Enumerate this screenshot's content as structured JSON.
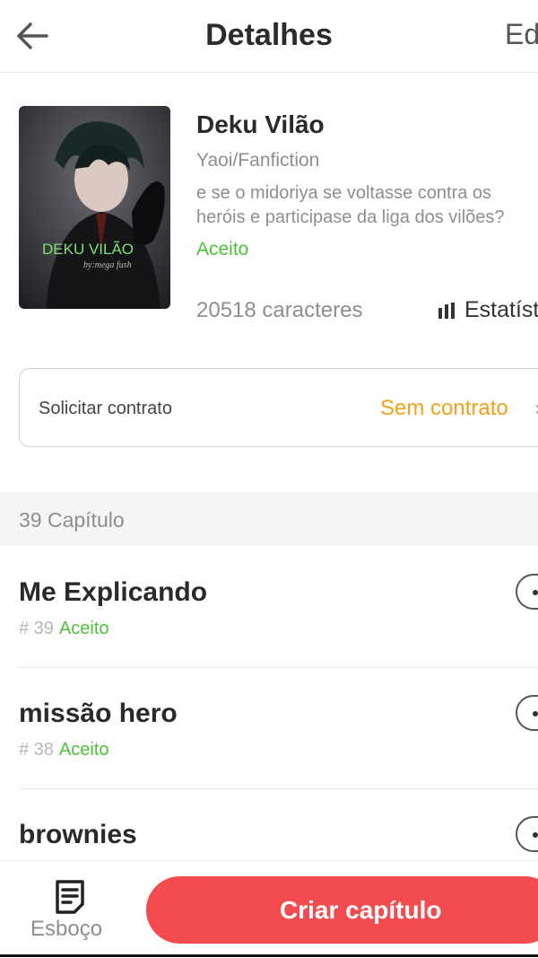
{
  "header": {
    "back_icon": "arrow-left-icon",
    "title": "Detalhes",
    "edit_label": "Ed"
  },
  "book": {
    "cover_text": "DEKU  VILÃO",
    "cover_signature": "by:mega fush",
    "title": "Deku Vilão",
    "genre": "Yaoi/Fanfiction",
    "description_line1": "e se o midoriya se voltasse contra os",
    "description_line2": "heróis e participase da liga dos vilões?",
    "status": "Aceito",
    "characters": "20518 caracteres",
    "stats_icon": "bar-chart-icon",
    "stats_label": "Estatísticas"
  },
  "contract": {
    "label": "Solicitar contrato",
    "value": "Sem contrato",
    "chevron": "›"
  },
  "chapters_section": {
    "count_label": "39 Capítulo"
  },
  "chapters": [
    {
      "title": "Me Explicando",
      "number": "# 39",
      "status": "Aceito"
    },
    {
      "title": "missão hero",
      "number": "# 38",
      "status": "Aceito"
    },
    {
      "title": "brownies",
      "number": "",
      "status": ""
    }
  ],
  "bottom_bar": {
    "draft_icon": "draft-document-icon",
    "draft_label": "Esboço",
    "create_button": "Criar capítulo"
  },
  "colors": {
    "accent_red": "#f34b50",
    "accepted_green": "#4cc23a",
    "contract_orange": "#f4a01a"
  }
}
